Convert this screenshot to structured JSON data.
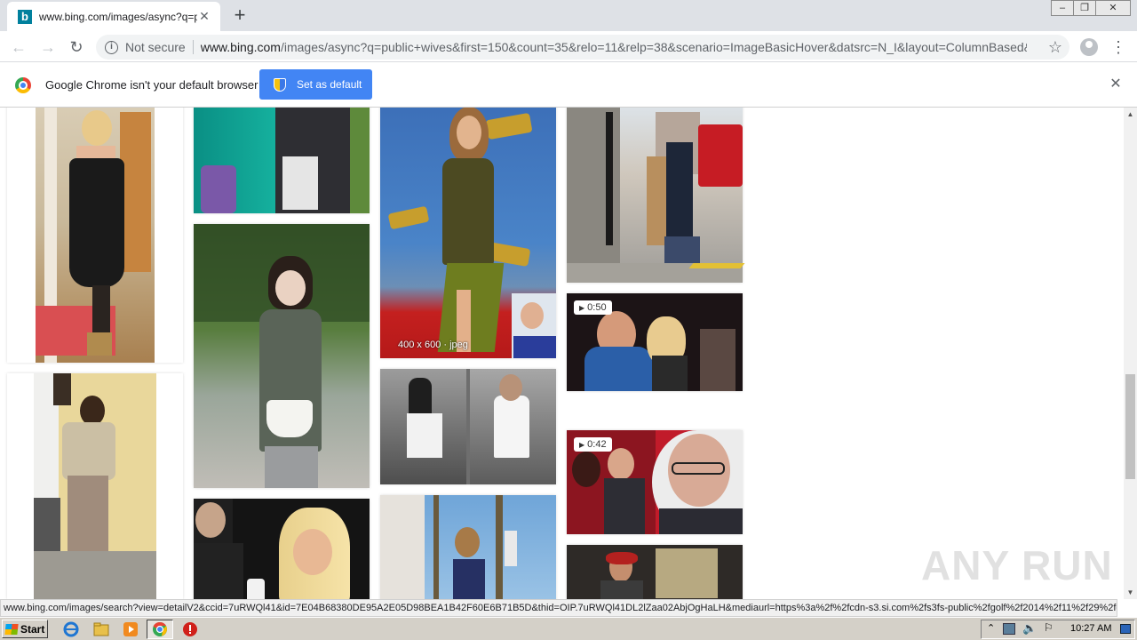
{
  "browser": {
    "tab": {
      "favicon_letter": "b",
      "title": "www.bing.com/images/async?q=pub",
      "close_glyph": "✕"
    },
    "new_tab_glyph": "+",
    "window_controls": {
      "minimize": "‒",
      "restore": "❐",
      "close": "✕"
    },
    "toolbar": {
      "back_glyph": "←",
      "forward_glyph": "→",
      "reload_glyph": "↻",
      "security_label": "Not secure",
      "url_host": "www.bing.com",
      "url_path": "/images/async?q=public+wives&first=150&count=35&relo=11&relp=38&scenario=ImageBasicHover&datsrc=N_I&layout=ColumnBased&...",
      "star_glyph": "☆",
      "menu_glyph": "⋮"
    },
    "infobar": {
      "message": "Google Chrome isn't your default browser",
      "button_label": "Set as default",
      "close_glyph": "✕"
    },
    "status_url": "www.bing.com/images/search?view=detailV2&ccid=7uRWQl41&id=7E04B68380DE95A2E05D98BEA1B42F60E6B71B5D&thid=OIP.7uRWQl41DL2lZaa02AbjOgHaLH&mediaurl=https%3a%2f%2fcdn-s3.si.com%2fs3fs-public%2fgolf%2f2014%2f11%2f29%2fg..."
  },
  "results": {
    "hover_label": "400 x 600 · jpeg",
    "video_badges": [
      {
        "duration": "0:50"
      },
      {
        "duration": "0:42"
      }
    ],
    "icons": {
      "play": "▶"
    }
  },
  "watermark": "ANY RUN",
  "scrollbar": {
    "up_glyph": "▲",
    "down_glyph": "▼"
  },
  "taskbar": {
    "start_label": "Start",
    "clock": "10:27 AM"
  },
  "colors": {
    "accent_blue": "#4285f4",
    "bing_teal": "#00809d",
    "tab_strip": "#dee1e6"
  }
}
